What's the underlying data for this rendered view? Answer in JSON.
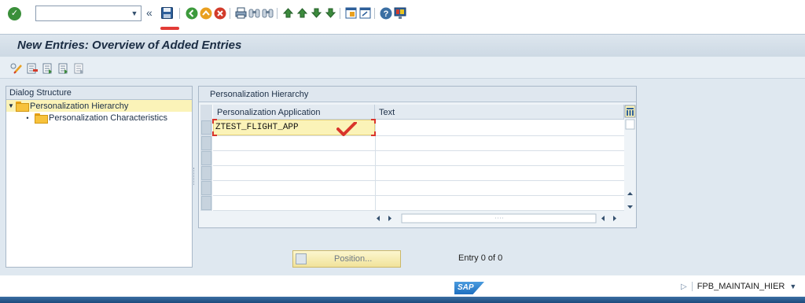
{
  "toolbar": {
    "command_field_value": "",
    "icons": [
      "enter-icon",
      "command-dropdown-icon",
      "double-left-icon",
      "save-icon",
      "back-icon",
      "exit-icon",
      "cancel-icon",
      "print-icon",
      "find-icon",
      "find-next-icon",
      "first-page-icon",
      "previous-page-icon",
      "next-page-icon",
      "last-page-icon",
      "new-session-icon",
      "create-shortcut-icon",
      "help-icon",
      "customize-layout-icon"
    ],
    "save_highlight_color": "#e23b36"
  },
  "title": "New Entries: Overview of Added Entries",
  "app_toolbar": {
    "icons": [
      "display-change-icon",
      "delete-icon",
      "select-all-icon",
      "select-block-icon",
      "deselect-all-icon"
    ]
  },
  "dialog_structure": {
    "header": "Dialog Structure",
    "items": [
      {
        "label": "Personalization Hierarchy",
        "selected": true,
        "expanded": true,
        "icon": "folder-open-icon"
      },
      {
        "label": "Personalization Characteristics",
        "selected": false,
        "icon": "folder-icon"
      }
    ]
  },
  "table": {
    "title": "Personalization Hierarchy",
    "columns": [
      "Personalization Application",
      "Text"
    ],
    "rows": [
      {
        "application": "ZTEST_FLIGHT_APP",
        "text": ""
      },
      {
        "application": "",
        "text": ""
      },
      {
        "application": "",
        "text": ""
      },
      {
        "application": "",
        "text": ""
      },
      {
        "application": "",
        "text": ""
      },
      {
        "application": "",
        "text": ""
      }
    ],
    "annotation_color": "#d9342b"
  },
  "position_button": {
    "label": "Position..."
  },
  "entry_info": "Entry 0 of 0",
  "status": {
    "logo": "SAP",
    "transaction": "FPB_MAINTAIN_HIER"
  }
}
